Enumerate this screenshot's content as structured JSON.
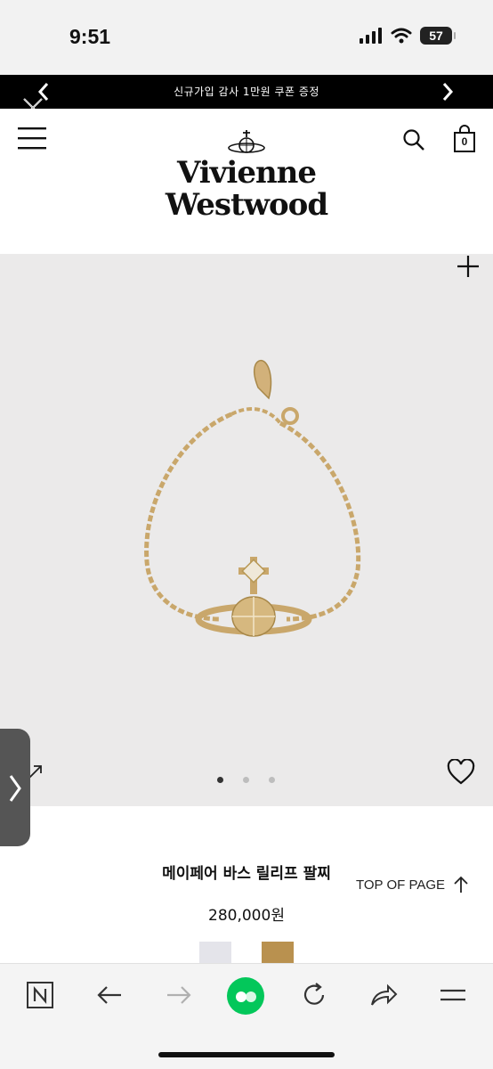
{
  "status_bar": {
    "time": "9:51",
    "battery": "57"
  },
  "promo": {
    "text": "신규가입 감사 1만원 쿠폰 증정"
  },
  "header": {
    "brand_line1": "Vivienne",
    "brand_line2": "Westwood",
    "cart_count": "0"
  },
  "gallery": {
    "slide_count": 3,
    "active_slide": 1
  },
  "product": {
    "name": "메이페어 바스 릴리프 팔찌",
    "price": "280,000원"
  },
  "top_of_page": {
    "label": "TOP OF PAGE"
  },
  "swatches": [
    {
      "name": "silver",
      "color": "#e4e4ea"
    },
    {
      "name": "gold",
      "color": "#b9914f"
    }
  ],
  "colors": {
    "promo_bg": "#000000",
    "image_bg": "#ebeaea",
    "bracelet_gold": "#c9a76b",
    "browser_accent": "#03c75a"
  },
  "icons": [
    "close-icon",
    "menu-icon",
    "search-icon",
    "shopping-bag-icon",
    "plus-icon",
    "expand-icon",
    "heart-icon",
    "chevron-up-icon",
    "n-home-icon",
    "back-arrow-icon",
    "forward-arrow-icon",
    "greendot-icon",
    "refresh-icon",
    "share-icon",
    "menu-lines-icon"
  ]
}
